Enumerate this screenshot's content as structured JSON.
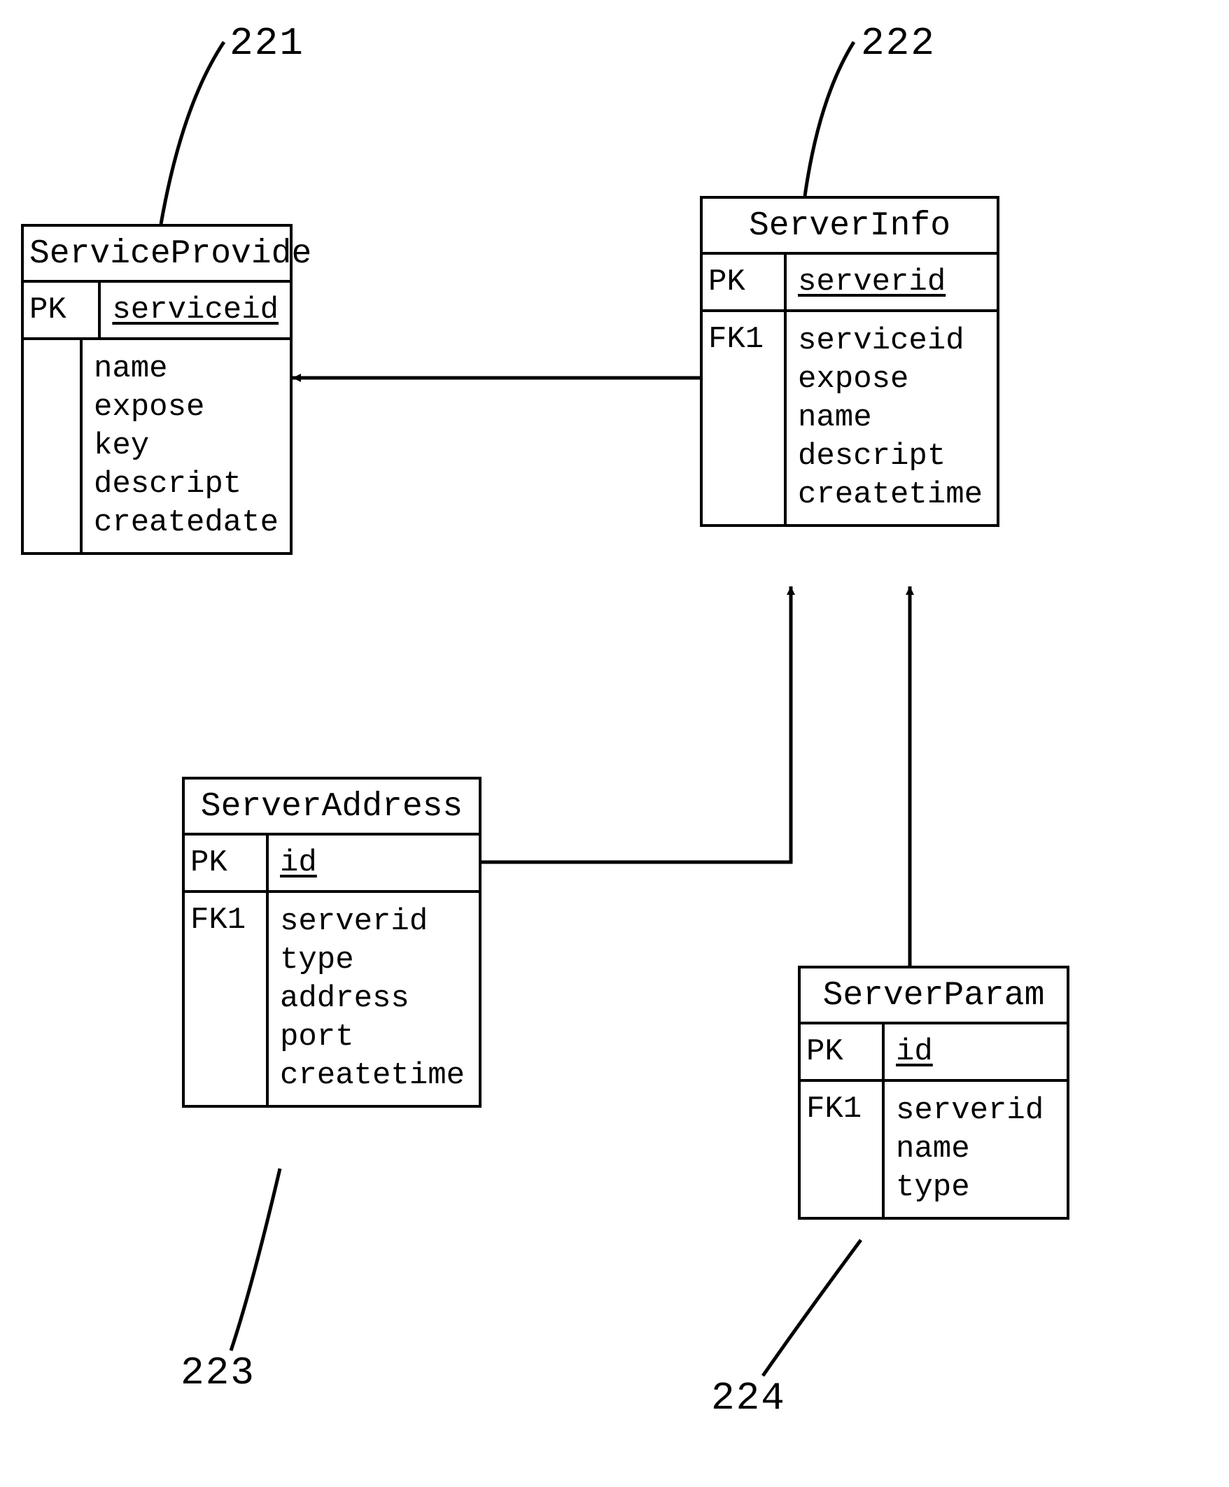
{
  "refs": {
    "e1": "221",
    "e2": "222",
    "e3": "223",
    "e4": "224"
  },
  "entities": {
    "serviceProvide": {
      "title": "ServiceProvide",
      "pkLabel": "PK",
      "pkField": "serviceid",
      "fkLabel": "",
      "fields": [
        "name",
        "expose",
        "key",
        "descript",
        "createdate"
      ]
    },
    "serverInfo": {
      "title": "ServerInfo",
      "pkLabel": "PK",
      "pkField": "serverid",
      "fkLabel": "FK1",
      "fields": [
        "serviceid",
        "expose",
        "name",
        "descript",
        "createtime"
      ]
    },
    "serverAddress": {
      "title": "ServerAddress",
      "pkLabel": "PK",
      "pkField": "id",
      "fkLabel": "FK1",
      "fields": [
        "serverid",
        "type",
        "address",
        "port",
        "createtime"
      ]
    },
    "serverParam": {
      "title": "ServerParam",
      "pkLabel": "PK",
      "pkField": "id",
      "fkLabel": "FK1",
      "fields": [
        "serverid",
        "name",
        "type"
      ]
    }
  }
}
